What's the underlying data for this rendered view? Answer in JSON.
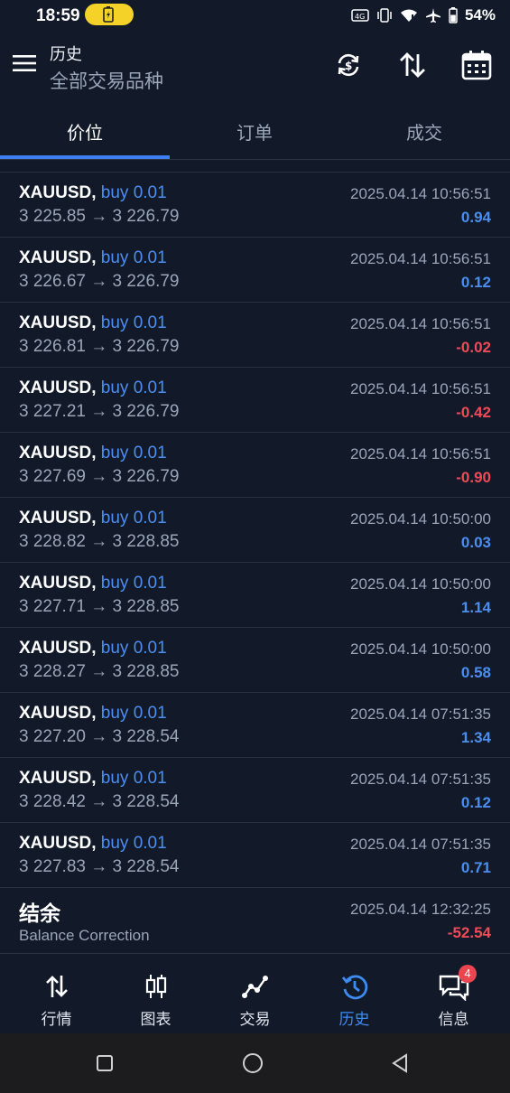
{
  "status_bar": {
    "time": "18:59",
    "battery_percent": "54%",
    "icons": [
      "volte-icon",
      "vibrate-icon",
      "wifi-icon",
      "airplane-icon",
      "battery-icon"
    ]
  },
  "header": {
    "title": "历史",
    "subtitle": "全部交易品种",
    "actions": [
      "sync-icon",
      "sort-icon",
      "calendar-icon"
    ]
  },
  "tabs": [
    {
      "label": "价位",
      "active": true
    },
    {
      "label": "订单",
      "active": false
    },
    {
      "label": "成交",
      "active": false
    }
  ],
  "deals": [
    {
      "symbol": "XAUUSD,",
      "direction": "buy 0.01",
      "prices": "3 225.85 → 3 226.79",
      "datetime": "2025.04.14 10:56:51",
      "profit": "0.94",
      "sign": "pos"
    },
    {
      "symbol": "XAUUSD,",
      "direction": "buy 0.01",
      "prices": "3 226.67 → 3 226.79",
      "datetime": "2025.04.14 10:56:51",
      "profit": "0.12",
      "sign": "pos"
    },
    {
      "symbol": "XAUUSD,",
      "direction": "buy 0.01",
      "prices": "3 226.81 → 3 226.79",
      "datetime": "2025.04.14 10:56:51",
      "profit": "-0.02",
      "sign": "neg"
    },
    {
      "symbol": "XAUUSD,",
      "direction": "buy 0.01",
      "prices": "3 227.21 → 3 226.79",
      "datetime": "2025.04.14 10:56:51",
      "profit": "-0.42",
      "sign": "neg"
    },
    {
      "symbol": "XAUUSD,",
      "direction": "buy 0.01",
      "prices": "3 227.69 → 3 226.79",
      "datetime": "2025.04.14 10:56:51",
      "profit": "-0.90",
      "sign": "neg"
    },
    {
      "symbol": "XAUUSD,",
      "direction": "buy 0.01",
      "prices": "3 228.82 → 3 228.85",
      "datetime": "2025.04.14 10:50:00",
      "profit": "0.03",
      "sign": "pos"
    },
    {
      "symbol": "XAUUSD,",
      "direction": "buy 0.01",
      "prices": "3 227.71 → 3 228.85",
      "datetime": "2025.04.14 10:50:00",
      "profit": "1.14",
      "sign": "pos"
    },
    {
      "symbol": "XAUUSD,",
      "direction": "buy 0.01",
      "prices": "3 228.27 → 3 228.85",
      "datetime": "2025.04.14 10:50:00",
      "profit": "0.58",
      "sign": "pos"
    },
    {
      "symbol": "XAUUSD,",
      "direction": "buy 0.01",
      "prices": "3 227.20 → 3 228.54",
      "datetime": "2025.04.14 07:51:35",
      "profit": "1.34",
      "sign": "pos"
    },
    {
      "symbol": "XAUUSD,",
      "direction": "buy 0.01",
      "prices": "3 228.42 → 3 228.54",
      "datetime": "2025.04.14 07:51:35",
      "profit": "0.12",
      "sign": "pos"
    },
    {
      "symbol": "XAUUSD,",
      "direction": "buy 0.01",
      "prices": "3 227.83 → 3 228.54",
      "datetime": "2025.04.14 07:51:35",
      "profit": "0.71",
      "sign": "pos"
    }
  ],
  "balance": {
    "title": "结余",
    "subtitle": "Balance Correction",
    "datetime": "2025.04.14 12:32:25",
    "amount": "-52.54"
  },
  "bottom_nav": {
    "items": [
      {
        "label": "行情",
        "icon": "quotes-icon"
      },
      {
        "label": "图表",
        "icon": "chart-icon"
      },
      {
        "label": "交易",
        "icon": "trade-icon"
      },
      {
        "label": "历史",
        "icon": "history-icon",
        "active": true
      },
      {
        "label": "信息",
        "icon": "messages-icon",
        "badge": "4"
      }
    ]
  },
  "colors": {
    "background": "#121a2a",
    "accent": "#3d7ef0",
    "profit_positive": "#4c8ef0",
    "profit_negative": "#f04a58",
    "muted_text": "#9aa5b6"
  }
}
